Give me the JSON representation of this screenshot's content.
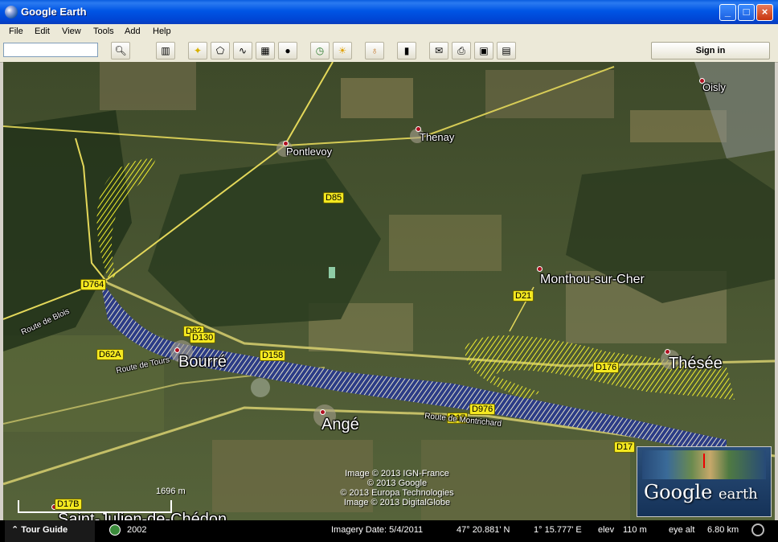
{
  "window": {
    "title": "Google Earth"
  },
  "menu": [
    "File",
    "Edit",
    "View",
    "Tools",
    "Add",
    "Help"
  ],
  "toolbar": {
    "search_placeholder": "",
    "sign_in": "Sign in",
    "icons": [
      "search-icon",
      "sidebar-icon",
      "placemark-icon",
      "polygon-icon",
      "path-icon",
      "image-overlay-icon",
      "record-tour-icon",
      "historical-imagery-icon",
      "sunlight-icon",
      "planets-icon",
      "ruler-icon",
      "email-icon",
      "print-icon",
      "save-image-icon",
      "view-maps-icon"
    ]
  },
  "map": {
    "places": {
      "pontlevoy": "Pontlevoy",
      "thenay": "Thenay",
      "oisly": "Oisly",
      "monthou": "Monthou-sur-Cher",
      "bourre": "Bourré",
      "these": "Thésée",
      "ange": "Angé",
      "saint_julien": "Saint-Julien-de-Chédon"
    },
    "roads": {
      "d764": "D764",
      "d85": "D85",
      "d62": "D62",
      "d130": "D130",
      "d62a": "D62A",
      "d158": "D158",
      "d21": "D21",
      "d176": "D176",
      "d976": "D976",
      "d17": "D17",
      "d17b": "D17B",
      "d1xx": "D17"
    },
    "street_labels": {
      "route_de_tours": "Route de Tours",
      "route_montrichard": "Route de Montrichard",
      "route_de_bl": "Route de Blois"
    },
    "credits": [
      "Image © 2013 IGN-France",
      "© 2013 Google",
      "© 2013 Europa Technologies",
      "Image © 2013 DigitalGlobe"
    ],
    "scale": "1696 m",
    "logo": {
      "google": "Google",
      "earth": "earth"
    }
  },
  "status": {
    "tour_guide": "Tour Guide",
    "year": "2002",
    "imagery_date": "Imagery Date: 5/4/2011",
    "lat": "47° 20.881' N",
    "lon": "1° 15.777' E",
    "elev_label": "elev",
    "elev": "110 m",
    "eye_alt_label": "eye alt",
    "eye_alt": "6.80 km"
  }
}
